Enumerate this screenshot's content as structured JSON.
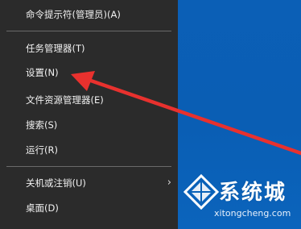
{
  "menu": {
    "items": [
      {
        "label": "命令提示符(管理员)(A)"
      },
      {
        "label": "任务管理器(T)"
      },
      {
        "label": "设置(N)"
      },
      {
        "label": "文件资源管理器(E)"
      },
      {
        "label": "搜索(S)"
      },
      {
        "label": "运行(R)"
      },
      {
        "label": "关机或注销(U)",
        "submenu_indicator": "›"
      },
      {
        "label": "桌面(D)"
      }
    ]
  },
  "annotation": {
    "arrow_color": "#e8312e",
    "target": "设置(N)"
  },
  "watermark": {
    "brand": "系统城",
    "url": "xitongcheng.com",
    "icon": "windows-logo-icon"
  },
  "colors": {
    "menu_bg": "#2b2b2b",
    "menu_text": "#f2f2f2",
    "separator": "#6a6a6a",
    "desktop_blue": "#0a62b8"
  }
}
